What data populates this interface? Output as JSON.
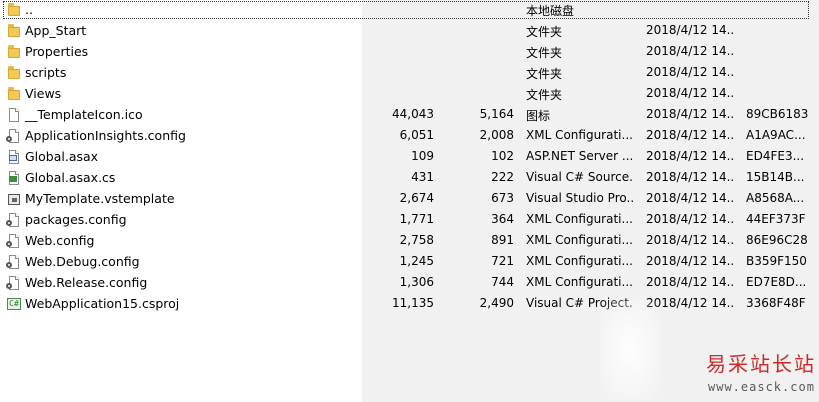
{
  "files": [
    {
      "icon": "folder-up-icon",
      "name": "..",
      "size": "",
      "packed": "",
      "type": "本地磁盘",
      "mtime": "",
      "crc": ""
    },
    {
      "icon": "folder-icon",
      "name": "App_Start",
      "size": "",
      "packed": "",
      "type": "文件夹",
      "mtime": "2018/4/12 14...",
      "crc": ""
    },
    {
      "icon": "folder-icon",
      "name": "Properties",
      "size": "",
      "packed": "",
      "type": "文件夹",
      "mtime": "2018/4/12 14...",
      "crc": ""
    },
    {
      "icon": "folder-icon",
      "name": "scripts",
      "size": "",
      "packed": "",
      "type": "文件夹",
      "mtime": "2018/4/12 14...",
      "crc": ""
    },
    {
      "icon": "folder-icon",
      "name": "Views",
      "size": "",
      "packed": "",
      "type": "文件夹",
      "mtime": "2018/4/12 14...",
      "crc": ""
    },
    {
      "icon": "icon-file-icon",
      "name": "__TemplateIcon.ico",
      "size": "44,043",
      "packed": "5,164",
      "type": "图标",
      "mtime": "2018/4/12 14...",
      "crc": "89CB6183"
    },
    {
      "icon": "config-file-icon",
      "name": "ApplicationInsights.config",
      "size": "6,051",
      "packed": "2,008",
      "type": "XML Configurati...",
      "mtime": "2018/4/12 14...",
      "crc": "A1A9AC..."
    },
    {
      "icon": "asax-file-icon",
      "name": "Global.asax",
      "size": "109",
      "packed": "102",
      "type": "ASP.NET Server ...",
      "mtime": "2018/4/12 14...",
      "crc": "ED4FE3..."
    },
    {
      "icon": "cs-file-icon",
      "name": "Global.asax.cs",
      "size": "431",
      "packed": "222",
      "type": "Visual C# Source...",
      "mtime": "2018/4/12 14...",
      "crc": "15B14B..."
    },
    {
      "icon": "vstemplate-file-icon",
      "name": "MyTemplate.vstemplate",
      "size": "2,674",
      "packed": "673",
      "type": "Visual Studio Pro...",
      "mtime": "2018/4/12 14...",
      "crc": "A8568A..."
    },
    {
      "icon": "config-file-icon",
      "name": "packages.config",
      "size": "1,771",
      "packed": "364",
      "type": "XML Configurati...",
      "mtime": "2018/4/12 14...",
      "crc": "44EF373F"
    },
    {
      "icon": "config-file-icon",
      "name": "Web.config",
      "size": "2,758",
      "packed": "891",
      "type": "XML Configurati...",
      "mtime": "2018/4/12 14...",
      "crc": "86E96C28"
    },
    {
      "icon": "config-file-icon",
      "name": "Web.Debug.config",
      "size": "1,245",
      "packed": "721",
      "type": "XML Configurati...",
      "mtime": "2018/4/12 14...",
      "crc": "B359F150"
    },
    {
      "icon": "config-file-icon",
      "name": "Web.Release.config",
      "size": "1,306",
      "packed": "744",
      "type": "XML Configurati...",
      "mtime": "2018/4/12 14...",
      "crc": "ED7E8D..."
    },
    {
      "icon": "csproj-file-icon",
      "name": "WebApplication15.csproj",
      "size": "11,135",
      "packed": "2,490",
      "type": "Visual C# Project...",
      "mtime": "2018/4/12 14...",
      "crc": "3368F48F"
    }
  ],
  "watermark": {
    "text": "易采站长站",
    "url": "www.easck.com",
    "color": "#cc2a2a"
  },
  "colors": {
    "list_background": "#ffffff",
    "column_background": "#f1f1f1",
    "folder": "#f3c955"
  }
}
